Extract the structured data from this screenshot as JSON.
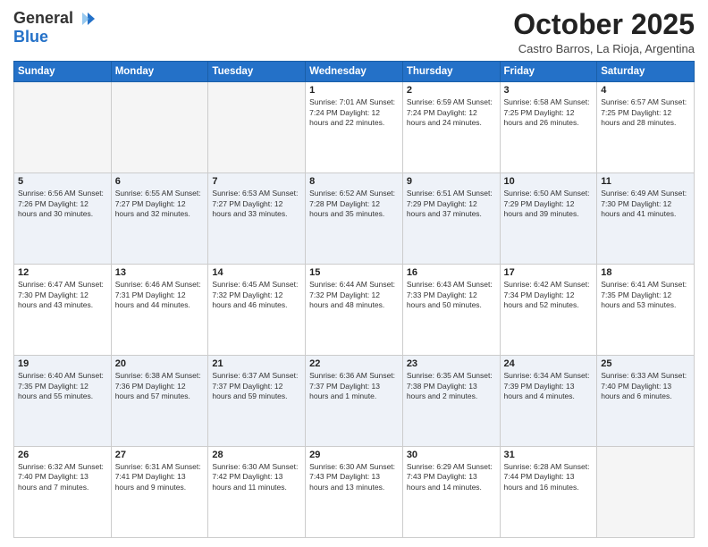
{
  "logo": {
    "general": "General",
    "blue": "Blue"
  },
  "header": {
    "month": "October 2025",
    "location": "Castro Barros, La Rioja, Argentina"
  },
  "days_of_week": [
    "Sunday",
    "Monday",
    "Tuesday",
    "Wednesday",
    "Thursday",
    "Friday",
    "Saturday"
  ],
  "weeks": [
    [
      {
        "day": "",
        "info": ""
      },
      {
        "day": "",
        "info": ""
      },
      {
        "day": "",
        "info": ""
      },
      {
        "day": "1",
        "info": "Sunrise: 7:01 AM\nSunset: 7:24 PM\nDaylight: 12 hours\nand 22 minutes."
      },
      {
        "day": "2",
        "info": "Sunrise: 6:59 AM\nSunset: 7:24 PM\nDaylight: 12 hours\nand 24 minutes."
      },
      {
        "day": "3",
        "info": "Sunrise: 6:58 AM\nSunset: 7:25 PM\nDaylight: 12 hours\nand 26 minutes."
      },
      {
        "day": "4",
        "info": "Sunrise: 6:57 AM\nSunset: 7:25 PM\nDaylight: 12 hours\nand 28 minutes."
      }
    ],
    [
      {
        "day": "5",
        "info": "Sunrise: 6:56 AM\nSunset: 7:26 PM\nDaylight: 12 hours\nand 30 minutes."
      },
      {
        "day": "6",
        "info": "Sunrise: 6:55 AM\nSunset: 7:27 PM\nDaylight: 12 hours\nand 32 minutes."
      },
      {
        "day": "7",
        "info": "Sunrise: 6:53 AM\nSunset: 7:27 PM\nDaylight: 12 hours\nand 33 minutes."
      },
      {
        "day": "8",
        "info": "Sunrise: 6:52 AM\nSunset: 7:28 PM\nDaylight: 12 hours\nand 35 minutes."
      },
      {
        "day": "9",
        "info": "Sunrise: 6:51 AM\nSunset: 7:29 PM\nDaylight: 12 hours\nand 37 minutes."
      },
      {
        "day": "10",
        "info": "Sunrise: 6:50 AM\nSunset: 7:29 PM\nDaylight: 12 hours\nand 39 minutes."
      },
      {
        "day": "11",
        "info": "Sunrise: 6:49 AM\nSunset: 7:30 PM\nDaylight: 12 hours\nand 41 minutes."
      }
    ],
    [
      {
        "day": "12",
        "info": "Sunrise: 6:47 AM\nSunset: 7:30 PM\nDaylight: 12 hours\nand 43 minutes."
      },
      {
        "day": "13",
        "info": "Sunrise: 6:46 AM\nSunset: 7:31 PM\nDaylight: 12 hours\nand 44 minutes."
      },
      {
        "day": "14",
        "info": "Sunrise: 6:45 AM\nSunset: 7:32 PM\nDaylight: 12 hours\nand 46 minutes."
      },
      {
        "day": "15",
        "info": "Sunrise: 6:44 AM\nSunset: 7:32 PM\nDaylight: 12 hours\nand 48 minutes."
      },
      {
        "day": "16",
        "info": "Sunrise: 6:43 AM\nSunset: 7:33 PM\nDaylight: 12 hours\nand 50 minutes."
      },
      {
        "day": "17",
        "info": "Sunrise: 6:42 AM\nSunset: 7:34 PM\nDaylight: 12 hours\nand 52 minutes."
      },
      {
        "day": "18",
        "info": "Sunrise: 6:41 AM\nSunset: 7:35 PM\nDaylight: 12 hours\nand 53 minutes."
      }
    ],
    [
      {
        "day": "19",
        "info": "Sunrise: 6:40 AM\nSunset: 7:35 PM\nDaylight: 12 hours\nand 55 minutes."
      },
      {
        "day": "20",
        "info": "Sunrise: 6:38 AM\nSunset: 7:36 PM\nDaylight: 12 hours\nand 57 minutes."
      },
      {
        "day": "21",
        "info": "Sunrise: 6:37 AM\nSunset: 7:37 PM\nDaylight: 12 hours\nand 59 minutes."
      },
      {
        "day": "22",
        "info": "Sunrise: 6:36 AM\nSunset: 7:37 PM\nDaylight: 13 hours\nand 1 minute."
      },
      {
        "day": "23",
        "info": "Sunrise: 6:35 AM\nSunset: 7:38 PM\nDaylight: 13 hours\nand 2 minutes."
      },
      {
        "day": "24",
        "info": "Sunrise: 6:34 AM\nSunset: 7:39 PM\nDaylight: 13 hours\nand 4 minutes."
      },
      {
        "day": "25",
        "info": "Sunrise: 6:33 AM\nSunset: 7:40 PM\nDaylight: 13 hours\nand 6 minutes."
      }
    ],
    [
      {
        "day": "26",
        "info": "Sunrise: 6:32 AM\nSunset: 7:40 PM\nDaylight: 13 hours\nand 7 minutes."
      },
      {
        "day": "27",
        "info": "Sunrise: 6:31 AM\nSunset: 7:41 PM\nDaylight: 13 hours\nand 9 minutes."
      },
      {
        "day": "28",
        "info": "Sunrise: 6:30 AM\nSunset: 7:42 PM\nDaylight: 13 hours\nand 11 minutes."
      },
      {
        "day": "29",
        "info": "Sunrise: 6:30 AM\nSunset: 7:43 PM\nDaylight: 13 hours\nand 13 minutes."
      },
      {
        "day": "30",
        "info": "Sunrise: 6:29 AM\nSunset: 7:43 PM\nDaylight: 13 hours\nand 14 minutes."
      },
      {
        "day": "31",
        "info": "Sunrise: 6:28 AM\nSunset: 7:44 PM\nDaylight: 13 hours\nand 16 minutes."
      },
      {
        "day": "",
        "info": ""
      }
    ]
  ]
}
